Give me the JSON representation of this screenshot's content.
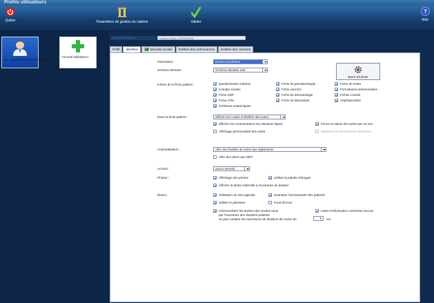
{
  "window": {
    "title": "Profils utilisateurs"
  },
  "toolbar": {
    "quit_label": "Quitter",
    "params_label": "Paramètres de gestion du cabinet",
    "validate_label": "Valider",
    "help_label": "Aide"
  },
  "users": [
    {
      "label": "NC - Docteur Ninon CREMONINI",
      "icon": "doctor-avatar-icon"
    },
    {
      "label": "<nouvel utilisateur>",
      "icon": "green-plus-icon"
    }
  ],
  "form": {
    "name_label": "Nom de l'utilisateur",
    "name_value": "Docteur Ninon CREMONINI"
  },
  "tabs": [
    {
      "label": "Profil",
      "active": false
    },
    {
      "label": "Interface",
      "active": true
    },
    {
      "label": "Sécurité sociale",
      "active": false,
      "icon": "sesam-card-icon"
    },
    {
      "label": "Entêtes des ordonnances",
      "active": false
    },
    {
      "label": "Entêtes des courriers",
      "active": false
    }
  ],
  "interface": {
    "orientation": {
      "label": "Orientation :",
      "value": "Dents et prothèse"
    },
    "schema": {
      "label": "Schéma dentaire :",
      "value": "Schéma dentaire trait"
    },
    "barre_icones_label": "Barre d'icônes",
    "icones": {
      "label": "Icônes de la fiche patient :",
      "col1": [
        {
          "label": "Questionnaire médical",
          "checked": true
        },
        {
          "label": "Compte-rendus",
          "checked": true
        },
        {
          "label": "Fiche ODF",
          "checked": true
        },
        {
          "label": "Fiche ATM",
          "checked": true
        },
        {
          "label": "Schémas anatomiques",
          "checked": true
        }
      ],
      "col2": [
        {
          "label": "Fiche de parodontologie",
          "checked": true
        },
        {
          "label": "Fiche cancéro",
          "checked": true
        },
        {
          "label": "Fiche de dermatologie",
          "checked": true
        },
        {
          "label": "Fiche de laboratoire",
          "checked": true
        }
      ],
      "col3": [
        {
          "label": "Fiche de teinte",
          "checked": true
        },
        {
          "label": "Formulaires personnalisés",
          "checked": true
        },
        {
          "label": "Fiches conseil",
          "checked": true
        },
        {
          "label": "Céphalométrie",
          "checked": true
        }
      ]
    },
    "fiche": {
      "label": "Dans la fiche patient :",
      "select_value": "afficher les codes et libellés des actes",
      "opt1": {
        "label": "afficher les commentaires sur plusieurs lignes",
        "checked": true
      },
      "opt2": {
        "label": "Affichage personnalisé des actes",
        "checked": false
      },
      "opt3": {
        "label": "Forcer la saisie des actes par un son",
        "checked": true
      },
      "opt4": {
        "label": "Masquer les informations médicales",
        "checked": false,
        "disabled": true
      }
    },
    "automatisation": {
      "label": "Automatisation :",
      "select_value": "Aller des feuilles de soins aux règlements",
      "opt": {
        "label": "Aller des devis aux DEP",
        "checked": false
      }
    },
    "arrondi": {
      "label": "Arrondi :",
      "value": "aucun arrondi"
    },
    "photos": {
      "label": "Photos :",
      "opt1": {
        "label": "Affichage des photos",
        "checked": true
      },
      "opt2": {
        "label": "Utiliser la palette d'images",
        "checked": true
      },
      "opt3": {
        "label": "Afficher la photo d'identité à l'ouverture du dossier",
        "checked": true
      }
    },
    "divers": {
      "label": "Divers :",
      "opt1": {
        "label": "Utilisation du mini agenda",
        "checked": true
      },
      "opt2": {
        "label": "Souhaiter l'anniversaire des patients",
        "checked": true
      },
      "opt3": {
        "label": "Utiliser le glossaire",
        "checked": true
      },
      "opt4": {
        "label": "Fond d'écran",
        "checked": false
      },
      "opt5_line1": "Chronométrer les durées des rendez-vous",
      "opt5_line2": "par l'ouverture des dossiers patients",
      "opt5_line3": "ne pas compter les ouvertures de dossiers de moins de",
      "opt5_checked": true,
      "opt5_value": "5",
      "opt5_unit": "mn",
      "opt6": {
        "label": "Lettre d'information LOGOSw OnLine",
        "checked": true
      }
    }
  }
}
